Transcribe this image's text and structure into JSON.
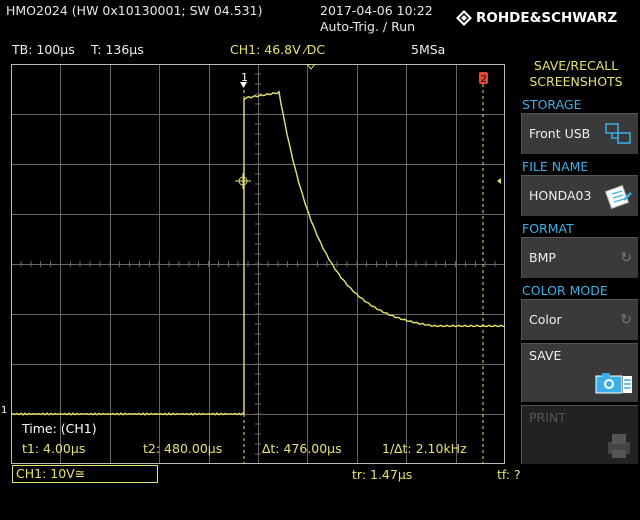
{
  "header": {
    "title": "HMO2024 (HW 0x10130001; SW 04.531)",
    "date": "2017-04-06 10:22",
    "trigger_mode": "Auto-Trig. / Run",
    "brand": "ROHDE&SCHWARZ"
  },
  "status_bar": {
    "timebase": "TB: 100µs",
    "time": "T: 136µs",
    "channel": "CH1: 46.8V ⁄DC",
    "sample_rate": "5MSa"
  },
  "markers": {
    "trigger": "1",
    "ref2": "2",
    "ch1_level": "1"
  },
  "cursors": {
    "source": "Time: (CH1)",
    "t1": "t1: 4.00µs",
    "t2": "t2: 480.00µs",
    "dt": "∆t: 476.00µs",
    "inv_dt": "1/∆t: 2.10kHz"
  },
  "footer": {
    "ch1_scale": "CH1: 10V≅",
    "rise_time": "tr: 1.47µs",
    "fall_time": "tf: ?"
  },
  "side_menu": {
    "title_line1": "SAVE/RECALL",
    "title_line2": "SCREENSHOTS",
    "storage_label": "STORAGE",
    "storage_value": "Front USB",
    "file_name_label": "FILE NAME",
    "file_name_value": "HONDA03",
    "format_label": "FORMAT",
    "format_value": "BMP",
    "color_mode_label": "COLOR MODE",
    "color_mode_value": "Color",
    "save_label": "SAVE",
    "print_label": "PRINT"
  },
  "colors": {
    "trace": "#e6e36c",
    "accent_blue": "#3bb0e8",
    "ref_marker": "#e8483c"
  }
}
